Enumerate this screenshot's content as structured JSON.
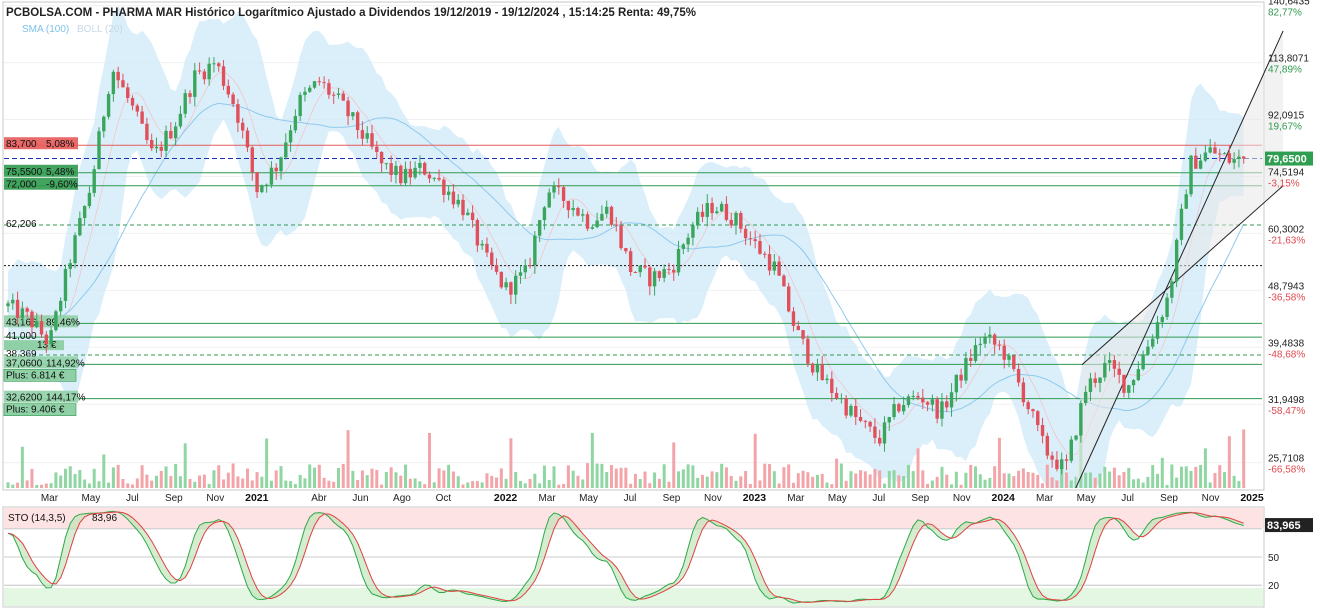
{
  "header": {
    "title": "PCBOLSA.COM - PHARMA MAR Histórico Logarítmico Ajustado a Dividendos 19/12/2019 - 19/12/2024 , 15:14:25 Renta: 49,75%",
    "indicators_sma": "SMA (100)",
    "indicators_boll": "BOLL (20)"
  },
  "colors": {
    "up": "#3aa55c",
    "down": "#e0505a",
    "boll_fill": "#cfe9f9",
    "sma": "#8fc9ec",
    "resistance": "#e85a5a",
    "support": "#2f9a4f",
    "dashed_blue": "#1c2fb8",
    "channel": "#bdbdbd",
    "stoch_fast": "#2fa848",
    "stoch_slow": "#e04040"
  },
  "chart_data": [
    {
      "type": "candlestick",
      "scale": "log",
      "ylim": [
        23.4,
        141.5
      ],
      "price_ticks": [
        "140,6435",
        "113,8071",
        "92,0915",
        "74,5194",
        "60,3002",
        "48,7943",
        "39,4838",
        "31,9498",
        "25,7108"
      ],
      "price_tick_values": [
        140.6435,
        113.8071,
        92.0915,
        74.5194,
        60.3002,
        48.7943,
        39.4838,
        31.9498,
        25.7108
      ],
      "percent_ticks": [
        "82,77%",
        "47,89%",
        "19,67%",
        "-3,15%",
        "-21,63%",
        "-36,58%",
        "-48,68%",
        "-58,47%",
        "-66,58%"
      ],
      "last_price": "79,6500",
      "x_labels": [
        {
          "text": "Mar",
          "month": 2
        },
        {
          "text": "May",
          "month": 4
        },
        {
          "text": "Jul",
          "month": 6
        },
        {
          "text": "Sep",
          "month": 8
        },
        {
          "text": "Nov",
          "month": 10
        },
        {
          "text": "2021",
          "month": 12,
          "year": true
        },
        {
          "text": "Abr",
          "month": 15
        },
        {
          "text": "Jun",
          "month": 17
        },
        {
          "text": "Ago",
          "month": 19
        },
        {
          "text": "Oct",
          "month": 21
        },
        {
          "text": "2022",
          "month": 24,
          "year": true
        },
        {
          "text": "Mar",
          "month": 26
        },
        {
          "text": "May",
          "month": 28
        },
        {
          "text": "Jul",
          "month": 30
        },
        {
          "text": "Sep",
          "month": 32
        },
        {
          "text": "Nov",
          "month": 34
        },
        {
          "text": "2023",
          "month": 36,
          "year": true
        },
        {
          "text": "Mar",
          "month": 38
        },
        {
          "text": "May",
          "month": 40
        },
        {
          "text": "Jul",
          "month": 42
        },
        {
          "text": "Sep",
          "month": 44
        },
        {
          "text": "Nov",
          "month": 46
        },
        {
          "text": "2024",
          "month": 48,
          "year": true
        },
        {
          "text": "Mar",
          "month": 50
        },
        {
          "text": "May",
          "month": 52
        },
        {
          "text": "Jul",
          "month": 54
        },
        {
          "text": "Sep",
          "month": 56
        },
        {
          "text": "Nov",
          "month": 58
        },
        {
          "text": "2025",
          "month": 60,
          "year": true
        }
      ],
      "price_path_months": [
        0,
        1,
        2,
        3,
        4,
        5,
        6,
        7,
        8,
        9,
        10,
        11,
        12,
        13,
        14,
        15,
        16,
        17,
        18,
        19,
        20,
        21,
        22,
        23,
        24,
        25,
        26,
        27,
        28,
        29,
        30,
        31,
        32,
        33,
        34,
        35,
        36,
        37,
        38,
        39,
        40,
        41,
        42,
        43,
        44,
        45,
        46,
        47,
        48,
        49,
        50,
        51,
        52,
        53,
        54,
        55,
        56,
        57,
        58,
        59,
        59.6
      ],
      "price_path_values": [
        46,
        44,
        40,
        55,
        72,
        112,
        96,
        80,
        90,
        108,
        114,
        96,
        71,
        78,
        98,
        106,
        98,
        88,
        78,
        74,
        77,
        72,
        66,
        55,
        49,
        52,
        71,
        68,
        63,
        66,
        53,
        51,
        53,
        62,
        67,
        64,
        58,
        53,
        42,
        36,
        33,
        30,
        28,
        32,
        33,
        31,
        36,
        41,
        39,
        33,
        27,
        25,
        34,
        37,
        34,
        40,
        48,
        78,
        82,
        79,
        79.65
      ],
      "levels": [
        {
          "price": "83,700",
          "pct": "5,08%",
          "kind": "resistance"
        },
        {
          "price": "75,5500",
          "pct": "5,48%",
          "kind": "support"
        },
        {
          "price": "72,000",
          "pct": "-9,60%",
          "kind": "support"
        },
        {
          "price": "62,206",
          "pct": "",
          "kind": "dashed"
        },
        {
          "price": "43,166",
          "pct": "89,46%",
          "kind": "support"
        },
        {
          "price": "41,000",
          "pct": "",
          "kind": "support"
        },
        {
          "price": "38,369",
          "pct": "",
          "kind": "dashed"
        },
        {
          "price": "37,0600",
          "pct": "114,92%",
          "kind": "support"
        },
        {
          "price": "32,6200",
          "pct": "144,17%",
          "kind": "support"
        }
      ],
      "level_values": [
        83.7,
        75.55,
        72.0,
        62.206,
        43.166,
        41.0,
        38.369,
        37.06,
        32.62
      ],
      "plus_labels": [
        "Plus: 6.814 €",
        "Plus: 9.406 €"
      ],
      "partial_label": "13 €"
    },
    {
      "type": "line",
      "name": "STO (14,3,5)",
      "value": "83,96",
      "last_value": "83,965",
      "ylim": [
        0,
        100
      ],
      "levels": [
        {
          "value": 80,
          "label": ""
        },
        {
          "value": 50,
          "label": "50"
        },
        {
          "value": 20,
          "label": "20"
        }
      ]
    }
  ]
}
